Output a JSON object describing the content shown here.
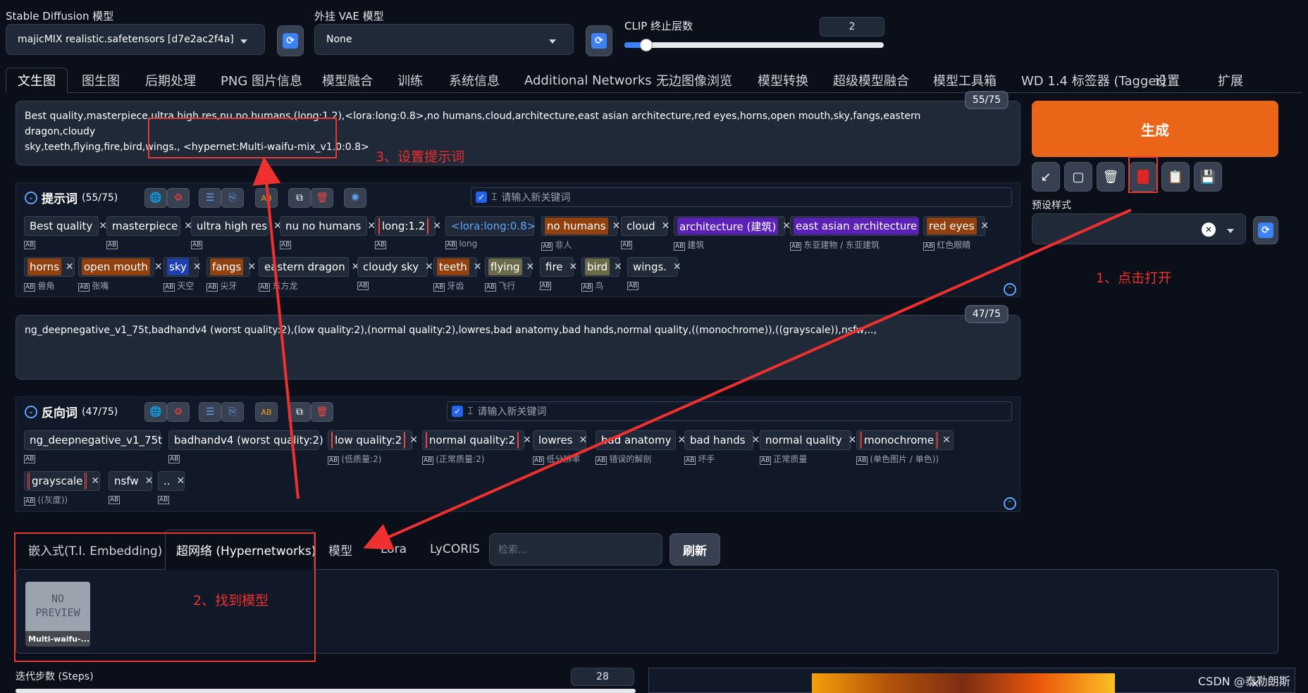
{
  "top": {
    "sd_label": "Stable Diffusion 模型",
    "sd_value": "majicMIX realistic.safetensors [d7e2ac2f4a]",
    "vae_label": "外挂 VAE 模型",
    "vae_value": "None",
    "clip_label": "CLIP 终止层数",
    "clip_value": "2",
    "clip_fraction": 0.083
  },
  "tabs": [
    "文生图",
    "图生图",
    "后期处理",
    "PNG 图片信息",
    "模型融合",
    "训练",
    "系统信息",
    "Additional Networks",
    "无边图像浏览",
    "模型转换",
    "超级模型融合",
    "模型工具箱",
    "WD 1.4 标签器 (Tagger)",
    "设置",
    "扩展"
  ],
  "prompt": {
    "line1": "Best quality,masterpiece,ultra high res,nu no humans,(long:1.2),<lora:long:0.8>,no humans,cloud,architecture,east asian architecture,red eyes,horns,open mouth,sky,fangs,eastern dragon,cloudy",
    "line2": "sky,teeth,flying,fire,bird,wings., <hypernet:Multi-waifu-mix_v1.0:0.8>",
    "counter": "55/75"
  },
  "pos_header": {
    "title": "提示词",
    "count": "(55/75)",
    "placeholder": "请输入新关键词"
  },
  "pos_tags": [
    {
      "t": "Best quality",
      "tr": ""
    },
    {
      "t": "masterpiece",
      "tr": ""
    },
    {
      "t": "ultra high res",
      "tr": ""
    },
    {
      "t": "nu no humans",
      "tr": ""
    },
    {
      "t": "long:1.2",
      "tr": ""
    },
    {
      "t": "<lora:long:0.8>",
      "tr": "long"
    },
    {
      "t": "no humans",
      "tr": "非人"
    },
    {
      "t": "cloud",
      "tr": ""
    },
    {
      "t": "architecture (建筑)",
      "tr": "建筑"
    },
    {
      "t": "east asian architecture",
      "tr": "东亚建物 / 东亚建筑"
    },
    {
      "t": "red eyes",
      "tr": "红色眼睛"
    },
    {
      "t": "horns",
      "tr": "兽角"
    },
    {
      "t": "open mouth",
      "tr": "张嘴"
    },
    {
      "t": "sky",
      "tr": "天空"
    },
    {
      "t": "fangs",
      "tr": "尖牙"
    },
    {
      "t": "eastern dragon",
      "tr": "东方龙"
    },
    {
      "t": "cloudy sky",
      "tr": ""
    },
    {
      "t": "teeth",
      "tr": "牙齿"
    },
    {
      "t": "flying",
      "tr": "飞行"
    },
    {
      "t": "fire",
      "tr": ""
    },
    {
      "t": "bird",
      "tr": "鸟"
    },
    {
      "t": "wings.",
      "tr": ""
    }
  ],
  "negative": {
    "text": "ng_deepnegative_v1_75t,badhandv4 (worst quality:2),(low quality:2),(normal quality:2),lowres,bad anatomy,bad hands,normal quality,((monochrome)),((grayscale)),nsfw,..,",
    "counter": "47/75"
  },
  "neg_header": {
    "title": "反向词",
    "count": "(47/75)",
    "placeholder": "请输入新关键词"
  },
  "neg_tags": [
    {
      "t": "ng_deepnegative_v1_75t",
      "tr": ""
    },
    {
      "t": "badhandv4 (worst quality:2)",
      "tr": ""
    },
    {
      "t": "low quality:2",
      "tr": "(低质量:2)"
    },
    {
      "t": "normal quality:2",
      "tr": "(正常质量:2)"
    },
    {
      "t": "lowres",
      "tr": "低分辨率"
    },
    {
      "t": "bad anatomy",
      "tr": "错误的解剖"
    },
    {
      "t": "bad hands",
      "tr": "坏手"
    },
    {
      "t": "normal quality",
      "tr": "正常质量"
    },
    {
      "t": "monochrome",
      "tr": "(单色图片 / 单色))"
    },
    {
      "t": "grayscale",
      "tr": "((灰度))"
    },
    {
      "t": "nsfw",
      "tr": ""
    },
    {
      "t": "..",
      "tr": ""
    }
  ],
  "generate_label": "生成",
  "preset_label": "预设样式",
  "network_tabs": [
    "嵌入式(T.I. Embedding)",
    "超网络 (Hypernetworks)",
    "模型",
    "Lora",
    "LyCORIS"
  ],
  "search_placeholder": "检索...",
  "refresh_label": "刷新",
  "card": {
    "preview": "NO PREVIEW",
    "name": "Multi-waifu-..."
  },
  "steps": {
    "label": "迭代步数 (Steps)",
    "value": "28"
  },
  "annotations": {
    "a1": "1、点击打开",
    "a2": "2、找到模型",
    "a3": "3、设置提示词"
  },
  "watermark": "CSDN @泰勒朗斯",
  "colors": {
    "generate": "#ea6517",
    "annotation": "#ef3030",
    "accent": "#3b82f6"
  }
}
